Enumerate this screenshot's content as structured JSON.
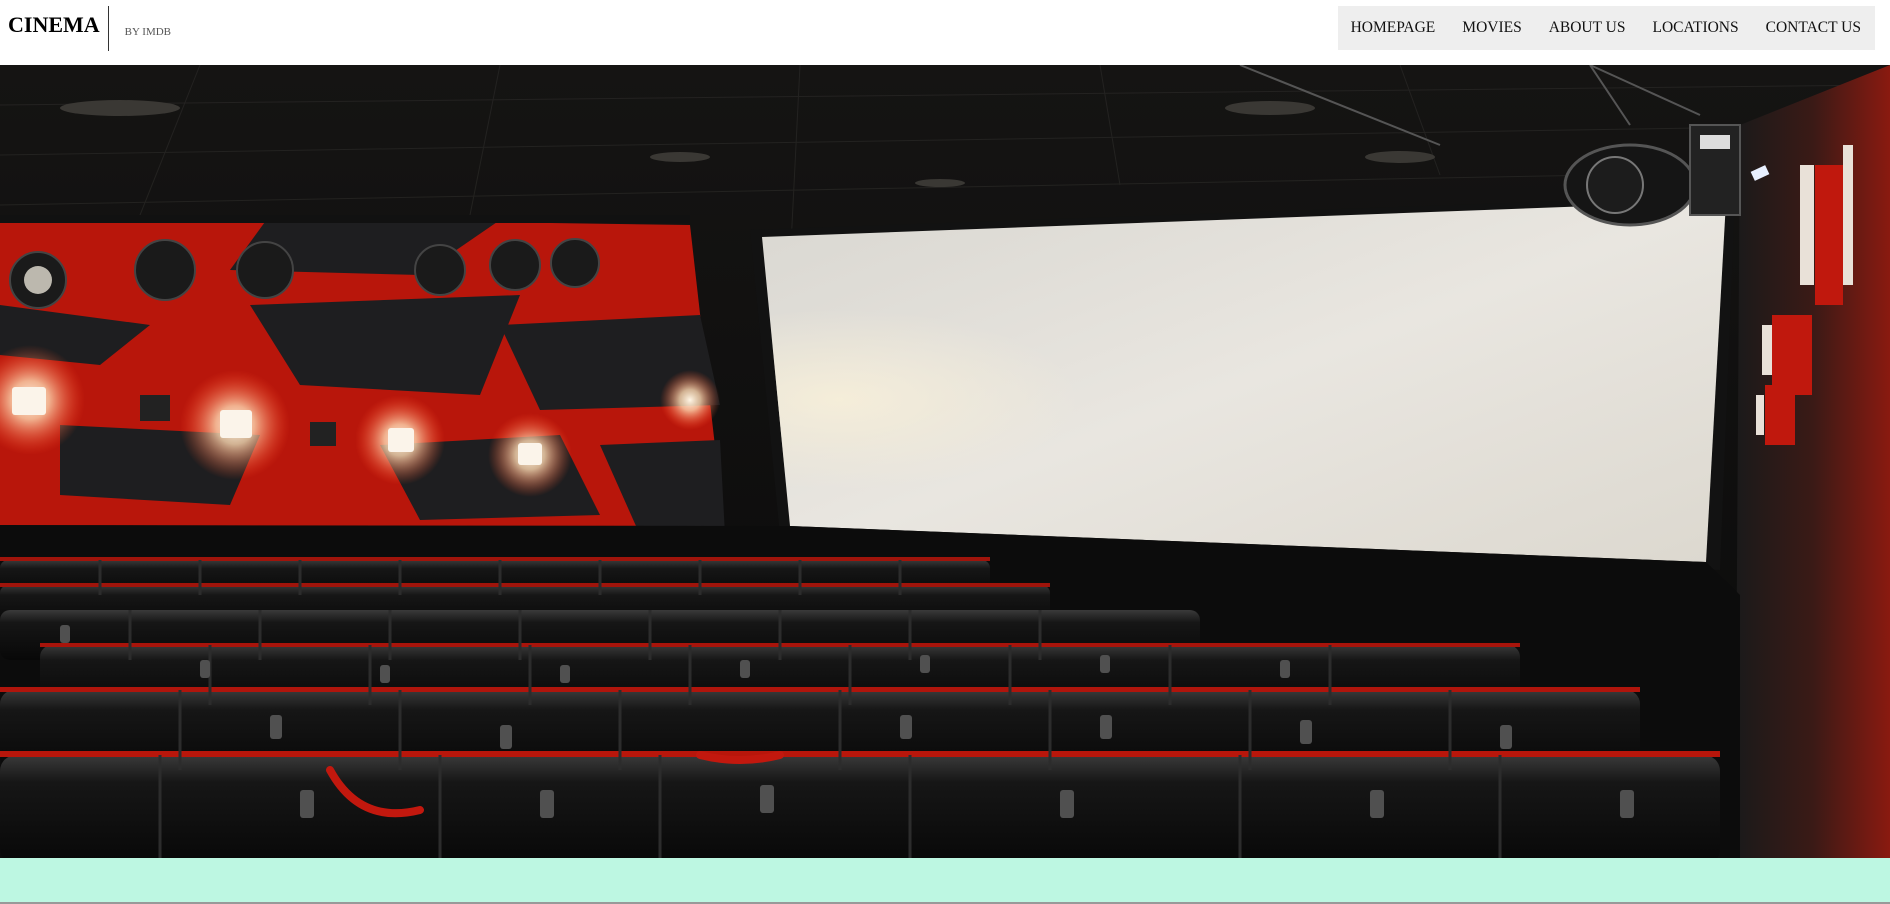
{
  "brand": {
    "title": "CINEMA",
    "subtitle": "BY IMDB"
  },
  "nav": {
    "items": [
      {
        "label": "HOMEPAGE"
      },
      {
        "label": "MOVIES"
      },
      {
        "label": "ABOUT US"
      },
      {
        "label": "LOCATIONS"
      },
      {
        "label": "CONTACT US"
      }
    ]
  },
  "hero": {
    "image": "cinema-auditorium-photo",
    "colors": {
      "wall_red": "#c81a0c",
      "wall_dark": "#1e1e20",
      "screen": "#e4e1db",
      "seat": "#141414",
      "seat_trim": "#b0150c"
    }
  },
  "band": {
    "color": "#bdf7e2"
  }
}
